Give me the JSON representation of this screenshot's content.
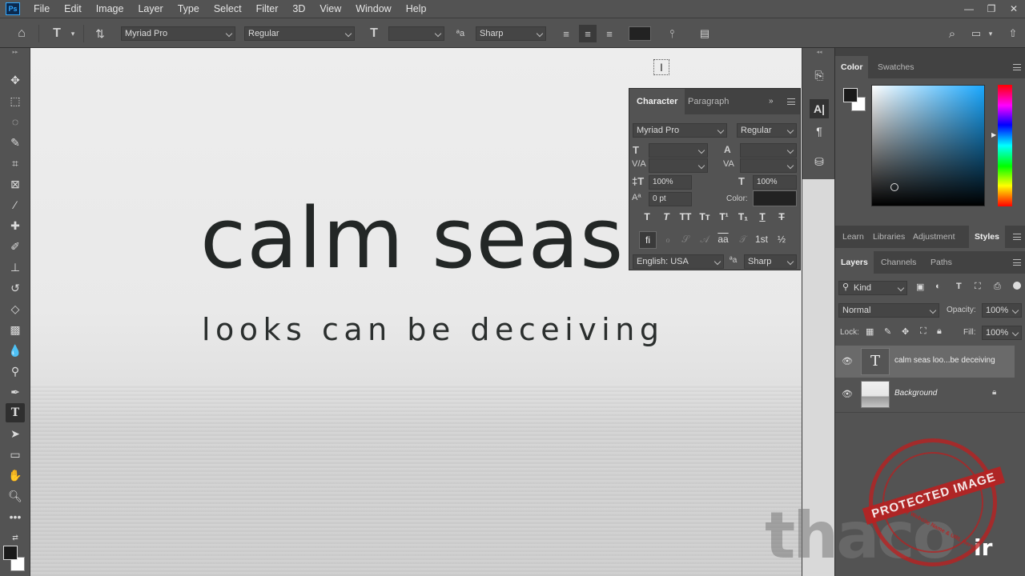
{
  "menu": [
    "File",
    "Edit",
    "Image",
    "Layer",
    "Type",
    "Select",
    "Filter",
    "3D",
    "View",
    "Window",
    "Help"
  ],
  "app_logo": "Ps",
  "options_bar": {
    "font_family": "Myriad Pro",
    "font_style": "Regular",
    "font_size": "",
    "antialias": "Sharp"
  },
  "canvas": {
    "headline": "calm seas",
    "subline": "looks can be deceiving"
  },
  "character_panel": {
    "tabs": [
      "Character",
      "Paragraph"
    ],
    "font_family": "Myriad Pro",
    "font_style": "Regular",
    "vertical_scale": "100%",
    "horizontal_scale": "100%",
    "baseline_shift": "0 pt",
    "color_label": "Color:",
    "language": "English: USA",
    "antialias": "Sharp",
    "fraction_glyph": "½",
    "ordinal_glyph": "1st"
  },
  "color_panel": {
    "tabs": [
      "Color",
      "Swatches"
    ],
    "foreground": "#1a1a1a",
    "background": "#ffffff",
    "hue_color": "#1aa8ff"
  },
  "library_tabs": [
    "Learn",
    "Libraries",
    "Adjustment",
    "Styles"
  ],
  "layers_panel": {
    "tabs": [
      "Layers",
      "Channels",
      "Paths"
    ],
    "filter_kind": "Kind",
    "blend_mode": "Normal",
    "opacity_label": "Opacity:",
    "opacity": "100%",
    "lock_label": "Lock:",
    "fill_label": "Fill:",
    "fill": "100%",
    "layers": [
      {
        "name": "calm seas loo...be deceiving",
        "type": "text"
      },
      {
        "name": "Background",
        "type": "image"
      }
    ]
  },
  "watermark": {
    "stamp": "PROTECTED IMAGE",
    "stamp_small": "My Website Name & URL Here",
    "brand": "thaco",
    "brand_suffix": "ir"
  }
}
